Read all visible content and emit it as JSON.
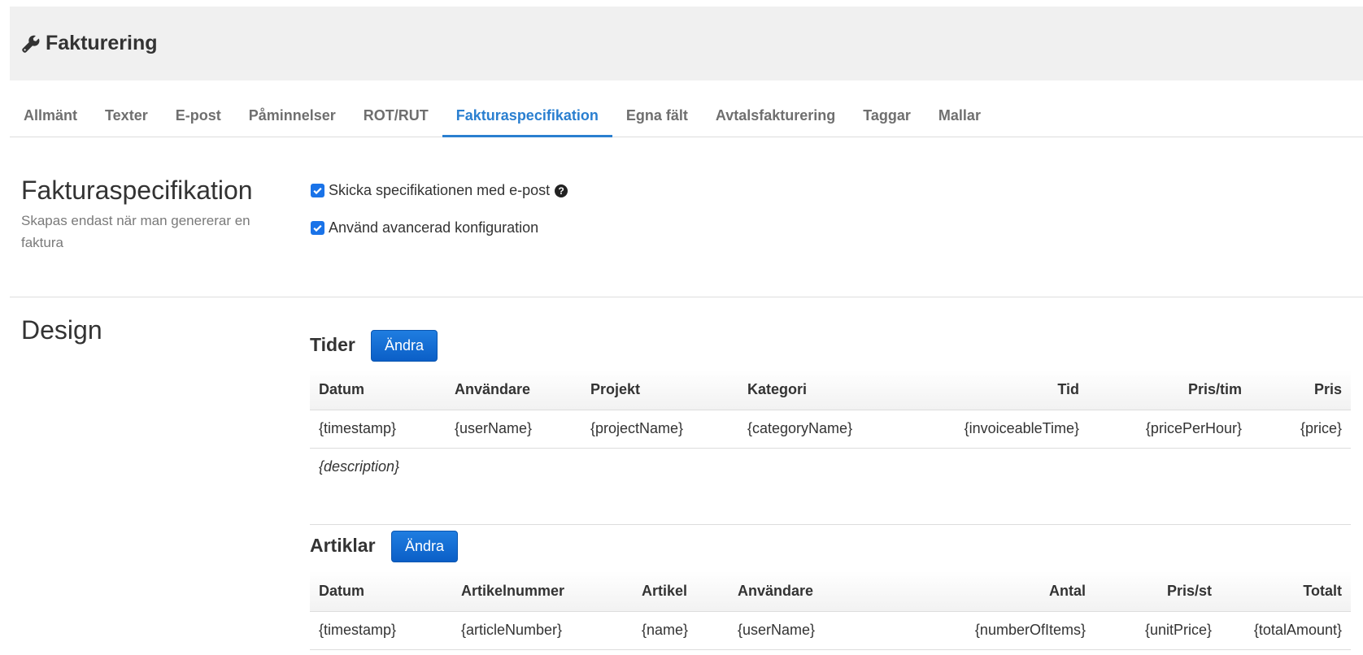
{
  "header": {
    "title": "Fakturering",
    "icon": "wrench-icon"
  },
  "tabs": [
    {
      "label": "Allmänt",
      "active": false
    },
    {
      "label": "Texter",
      "active": false
    },
    {
      "label": "E-post",
      "active": false
    },
    {
      "label": "Påminnelser",
      "active": false
    },
    {
      "label": "ROT/RUT",
      "active": false
    },
    {
      "label": "Fakturaspecifikation",
      "active": true
    },
    {
      "label": "Egna fält",
      "active": false
    },
    {
      "label": "Avtalsfakturering",
      "active": false
    },
    {
      "label": "Taggar",
      "active": false
    },
    {
      "label": "Mallar",
      "active": false
    }
  ],
  "spec_section": {
    "title": "Fakturaspecifikation",
    "subtitle": "Skapas endast när man genererar en faktura",
    "options": [
      {
        "label": "Skicka specifikationen med e-post",
        "checked": true,
        "help": "?"
      },
      {
        "label": "Använd avancerad konfiguration",
        "checked": true
      }
    ]
  },
  "design": {
    "title": "Design",
    "times": {
      "title": "Tider",
      "edit_label": "Ändra",
      "columns": [
        "Datum",
        "Användare",
        "Projekt",
        "Kategori",
        "Tid",
        "Pris/tim",
        "Pris"
      ],
      "row": [
        "{timestamp}",
        "{userName}",
        "{projectName}",
        "{categoryName}",
        "{invoiceableTime}",
        "{pricePerHour}",
        "{price}"
      ],
      "description": "{description}"
    },
    "articles": {
      "title": "Artiklar",
      "edit_label": "Ändra",
      "columns": [
        "Datum",
        "Artikelnummer",
        "Artikel",
        "Användare",
        "Antal",
        "Pris/st",
        "Totalt"
      ],
      "row": [
        "{timestamp}",
        "{articleNumber}",
        "{name}",
        "{userName}",
        "{numberOfItems}",
        "{unitPrice}",
        "{totalAmount}"
      ]
    }
  },
  "colors": {
    "accent": "#2a7fd0",
    "button": "#0b5fc7",
    "header_bg": "#f0f0f0"
  }
}
